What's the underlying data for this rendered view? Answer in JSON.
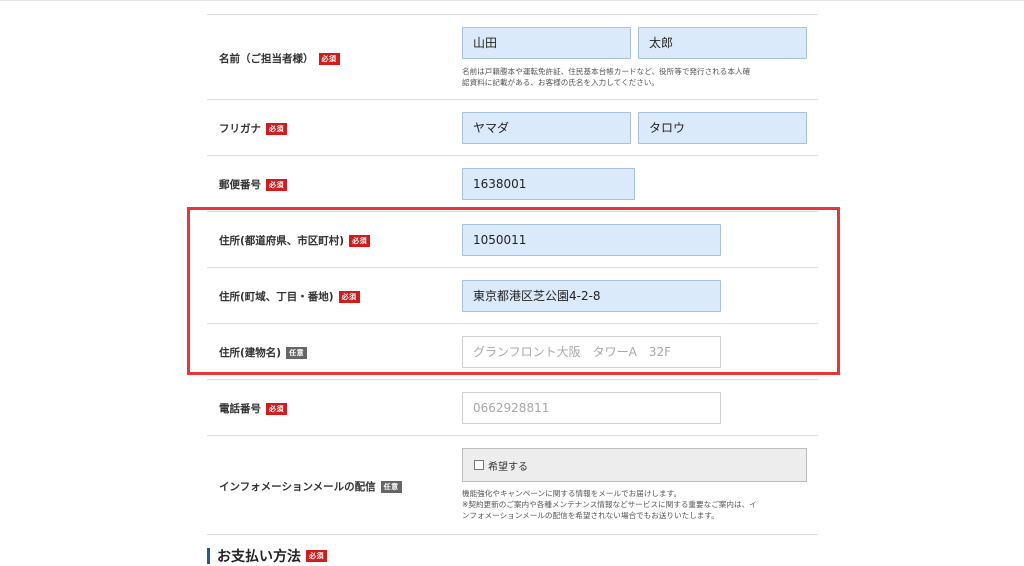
{
  "badges": {
    "required": "必須",
    "optional": "任意"
  },
  "fields": {
    "name": {
      "label": "名前（ご担当者様）",
      "last_value": "山田",
      "first_value": "太郎",
      "hint_line1": "名前は戸籍謄本や運転免許証、住民基本台帳カードなど、役所等で発行される本人確",
      "hint_line2": "認資料に記載がある、お客様の氏名を入力してください。"
    },
    "furigana": {
      "label": "フリガナ",
      "last_value": "ヤマダ",
      "first_value": "タロウ"
    },
    "postal_code": {
      "label": "郵便番号",
      "value": "1638001"
    },
    "address_pref_city": {
      "label": "住所(都道府県、市区町村)",
      "value": "1050011"
    },
    "address_street": {
      "label": "住所(町域、丁目・番地)",
      "value": "東京都港区芝公園4-2-8"
    },
    "address_building": {
      "label": "住所(建物名)",
      "placeholder": "グランフロント大阪　タワーA　32F"
    },
    "phone": {
      "label": "電話番号",
      "placeholder": "0662928811"
    },
    "newsletter": {
      "label": "インフォメーションメールの配信",
      "checkbox_label": "希望する",
      "hint_line1": "機能強化やキャンペーンに関する情報をメールでお届けします。",
      "hint_line2": "※契約更新のご案内や各種メンテナンス情報などサービスに関する重要なご案内は、イ",
      "hint_line3": "ンフォメーションメールの配信を希望されない場合でもお送りいたします。"
    }
  },
  "next_section": {
    "title": "お支払い方法"
  },
  "colors": {
    "required_badge": "#d41b1b",
    "optional_badge": "#666666",
    "filled_input": "#dbeafb",
    "highlight_border": "#e8343b"
  }
}
